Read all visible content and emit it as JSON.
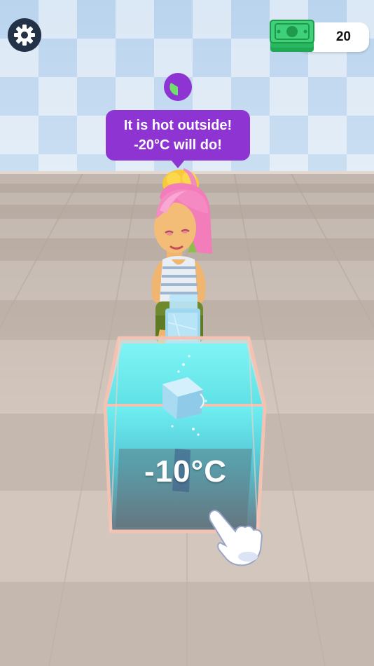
{
  "hud": {
    "settings_icon": "gear-icon",
    "cash_icon": "cash-stack-icon",
    "cash_amount": "20"
  },
  "customer": {
    "patience_icon": "timer-pie-icon",
    "speech_line1": "It is hot outside!",
    "speech_line2": "-20°C will do!"
  },
  "freezer": {
    "temperature": "-10°C"
  },
  "tutorial": {
    "hand_icon": "tap-hand-icon"
  },
  "colors": {
    "sky_checker_light": "#dfeaf6",
    "sky_checker_dark": "#b9d4ef",
    "floor_light": "#d6cbc2",
    "floor_dark": "#c4b7ad",
    "bubble": "#8e34d3",
    "settings_bg": "#233247",
    "cash_green": "#2ecc71",
    "water": "#63e4ea"
  }
}
